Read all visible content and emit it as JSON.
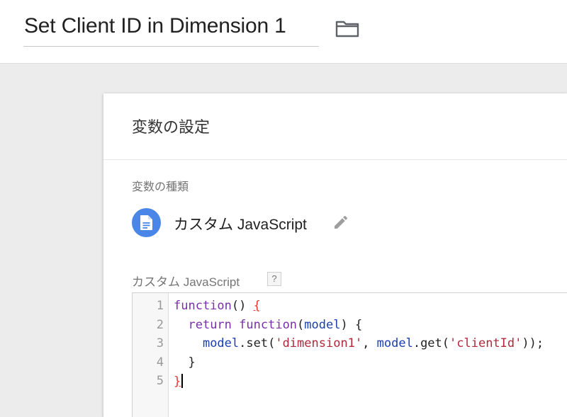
{
  "header": {
    "title": "Set Client ID in Dimension 1",
    "folder_icon": "folder-icon"
  },
  "card": {
    "title": "変数の設定",
    "variable_type_label": "変数の種類",
    "variable_type": {
      "icon": "document-icon",
      "icon_color": "#4a86e8",
      "name": "カスタム JavaScript",
      "edit_icon": "pencil-icon"
    },
    "code_label": "カスタム JavaScript",
    "help_label": "?"
  },
  "editor": {
    "line_numbers": [
      "1",
      "2",
      "3",
      "4",
      "5"
    ],
    "lines": [
      [
        {
          "t": "function",
          "c": "kw"
        },
        {
          "t": "() ",
          "c": "plain"
        },
        {
          "t": "{",
          "c": "bracket-match"
        }
      ],
      [
        {
          "t": "  ",
          "c": "plain"
        },
        {
          "t": "return",
          "c": "kw"
        },
        {
          "t": " ",
          "c": "plain"
        },
        {
          "t": "function",
          "c": "kw"
        },
        {
          "t": "(",
          "c": "plain"
        },
        {
          "t": "model",
          "c": "var"
        },
        {
          "t": ") {",
          "c": "plain"
        }
      ],
      [
        {
          "t": "    ",
          "c": "plain"
        },
        {
          "t": "model",
          "c": "var"
        },
        {
          "t": ".set(",
          "c": "plain"
        },
        {
          "t": "'dimension1'",
          "c": "str"
        },
        {
          "t": ", ",
          "c": "plain"
        },
        {
          "t": "model",
          "c": "var"
        },
        {
          "t": ".get(",
          "c": "plain"
        },
        {
          "t": "'clientId'",
          "c": "str"
        },
        {
          "t": "));",
          "c": "plain"
        }
      ],
      [
        {
          "t": "  }",
          "c": "plain"
        }
      ],
      [
        {
          "t": "}",
          "c": "bracket-match"
        }
      ]
    ]
  }
}
